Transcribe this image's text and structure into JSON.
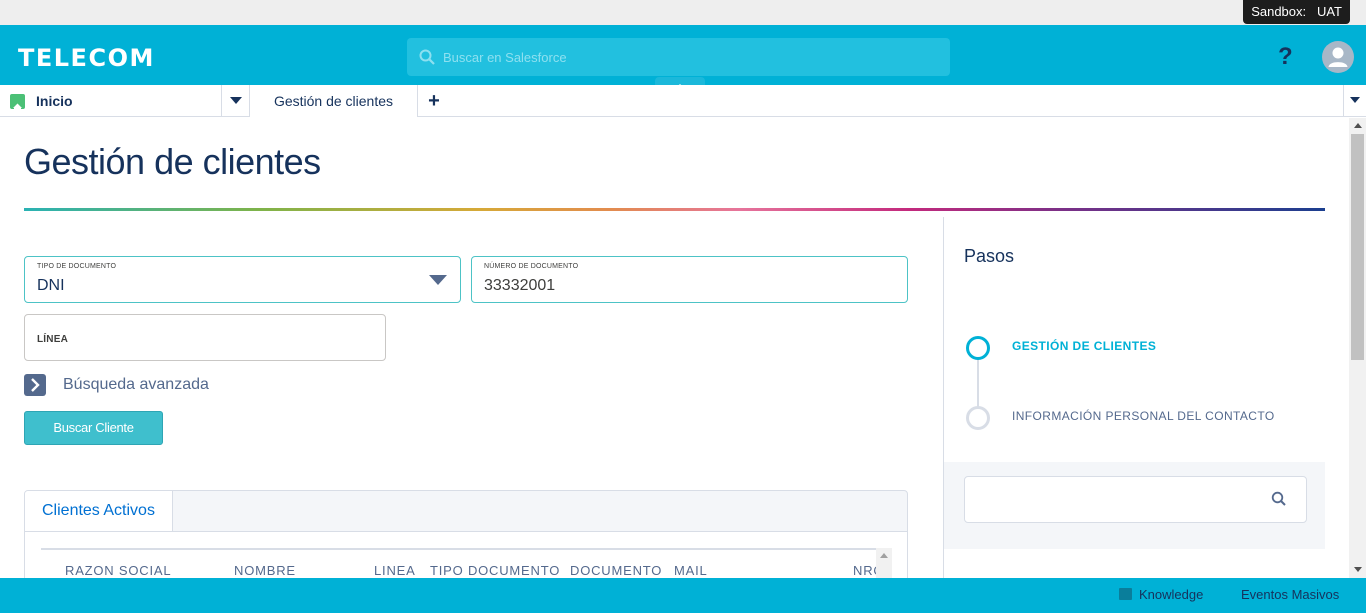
{
  "sandbox": {
    "label": "Sandbox:   UAT"
  },
  "header": {
    "logo": "TELECOM",
    "search_placeholder": "Buscar en Salesforce",
    "help_label": "?"
  },
  "tabs": {
    "home": "Inicio",
    "active": "Gestión de clientes",
    "add": "+"
  },
  "page": {
    "title": "Gestión de clientes"
  },
  "form": {
    "tipo_label": "TIPO DE DOCUMENTO",
    "tipo_value": "DNI",
    "numero_label": "NÚMERO DE DOCUMENTO",
    "numero_value": "33332001",
    "linea_label": "LÍNEA",
    "advanced_label": "Búsqueda avanzada",
    "search_button": "Buscar Cliente"
  },
  "results": {
    "tab": "Clientes Activos",
    "columns": [
      "RAZON SOCIAL",
      "NOMBRE",
      "LINEA",
      "TIPO DOCUMENTO",
      "DOCUMENTO",
      "MAIL",
      "NRO"
    ]
  },
  "steps": {
    "title": "Pasos",
    "items": [
      "GESTIÓN DE CLIENTES",
      "INFORMACIÓN PERSONAL DEL CONTACTO"
    ]
  },
  "utility": {
    "knowledge": "Knowledge",
    "eventos": "Eventos Masivos"
  },
  "colors": {
    "brand": "#00b1d6",
    "field_border": "#4dc3c6",
    "button": "#3fbfcd",
    "link": "#0070d2"
  }
}
